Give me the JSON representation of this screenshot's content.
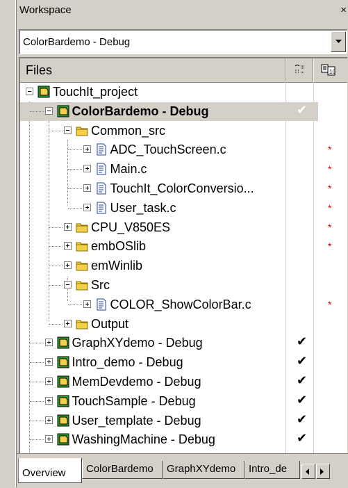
{
  "window": {
    "title": "Workspace",
    "close_glyph": "×"
  },
  "config_select": {
    "value": "ColorBardemo - Debug"
  },
  "tree_header": {
    "files_label": "Files",
    "col1_icon": "make-status-icon",
    "col2_icon": "options-icon"
  },
  "tree": [
    {
      "label": "TouchIt_project",
      "type": "workspace"
    },
    {
      "label": "ColorBardemo - Debug",
      "type": "project",
      "selected": true,
      "check": "✔"
    },
    {
      "label": "Common_src",
      "type": "folder"
    },
    {
      "label": "ADC_TouchScreen.c",
      "type": "file",
      "star": "*"
    },
    {
      "label": "Main.c",
      "type": "file",
      "star": "*"
    },
    {
      "label": "TouchIt_ColorConversio...",
      "type": "file",
      "star": "*"
    },
    {
      "label": "User_task.c",
      "type": "file",
      "star": "*"
    },
    {
      "label": "CPU_V850ES",
      "type": "folder",
      "star": "*"
    },
    {
      "label": "embOSlib",
      "type": "folder",
      "star": "*"
    },
    {
      "label": "emWinlib",
      "type": "folder"
    },
    {
      "label": "Src",
      "type": "folder"
    },
    {
      "label": "COLOR_ShowColorBar.c",
      "type": "file",
      "star": "*"
    },
    {
      "label": "Output",
      "type": "folder"
    },
    {
      "label": "GraphXYdemo - Debug",
      "type": "project",
      "check": "✔"
    },
    {
      "label": "Intro_demo - Debug",
      "type": "project",
      "check": "✔"
    },
    {
      "label": "MemDevdemo - Debug",
      "type": "project",
      "check": "✔"
    },
    {
      "label": "TouchSample - Debug",
      "type": "project",
      "check": "✔"
    },
    {
      "label": "User_template - Debug",
      "type": "project",
      "check": "✔"
    },
    {
      "label": "WashingMachine - Debug",
      "type": "project",
      "check": "✔"
    }
  ],
  "tabs": [
    "Overview",
    "ColorBardemo",
    "GraphXYdemo",
    "Intro_de"
  ],
  "colors": {
    "panel": "#d4d0c8",
    "project_icon_green": "#2e9e2e",
    "folder_yellow": "#f4d04a",
    "file_blue": "#2040a0",
    "star_red": "#e00000"
  }
}
